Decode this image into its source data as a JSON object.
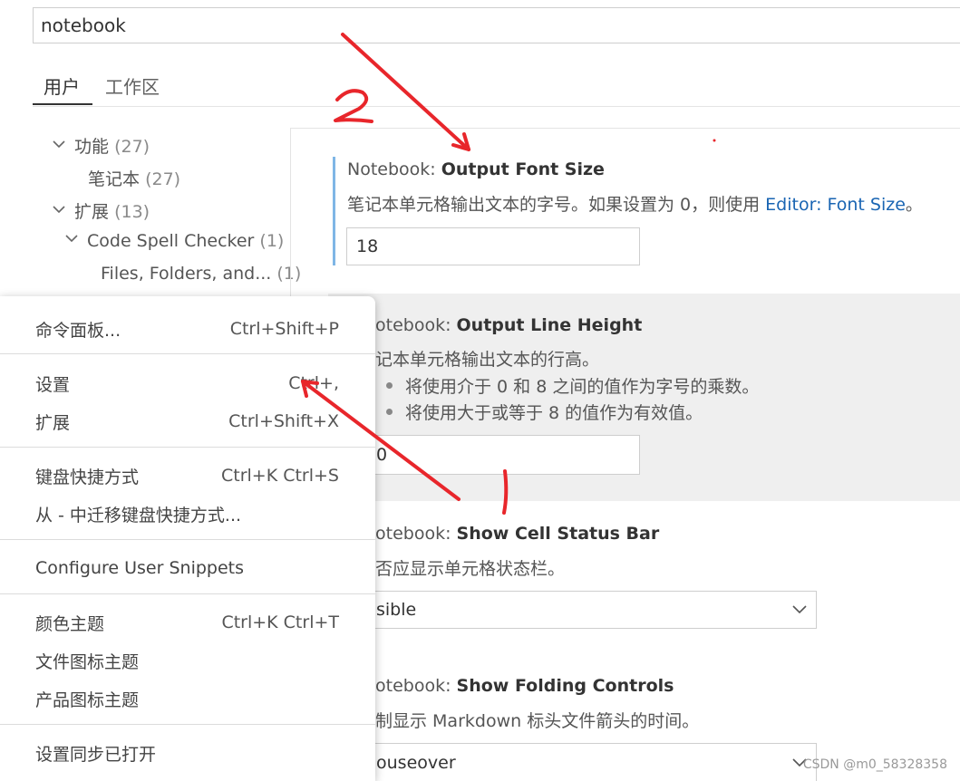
{
  "search": {
    "value": "notebook"
  },
  "tabs": [
    {
      "label": "用户"
    },
    {
      "label": "工作区"
    }
  ],
  "tree": [
    {
      "label": "功能",
      "count": "(27)"
    },
    {
      "label": "笔记本",
      "count": "(27)"
    },
    {
      "label": "扩展",
      "count": "(13)"
    },
    {
      "label": "Code Spell Checker",
      "count": "(1)"
    },
    {
      "label": "Files, Folders, and...",
      "count": "(1)"
    }
  ],
  "settings": [
    {
      "prefix": "Notebook: ",
      "name": "Output Font Size",
      "desc_before": "笔记本单元格输出文本的字号。如果设置为 0，则使用 ",
      "desc_link": "Editor: Font Size",
      "desc_after": "。",
      "value": "18"
    },
    {
      "prefix": "otebook: ",
      "name": "Output Line Height",
      "desc": "记本单元格输出文本的行高。",
      "bullets": [
        "将使用介于 0 和 8 之间的值作为字号的乘数。",
        "将使用大于或等于 8 的值作为有效值。"
      ],
      "value": "0"
    },
    {
      "prefix": "otebook: ",
      "name": "Show Cell Status Bar",
      "desc": "否应显示单元格状态栏。",
      "value": "sible"
    },
    {
      "prefix": "otebook: ",
      "name": "Show Folding Controls",
      "desc": "制显示 Markdown 标头文件箭头的时间。",
      "value": "ouseover"
    }
  ],
  "menu": {
    "groups": [
      [
        {
          "label": "命令面板...",
          "shortcut": "Ctrl+Shift+P"
        }
      ],
      [
        {
          "label": "设置",
          "shortcut": "Ctrl+,"
        },
        {
          "label": "扩展",
          "shortcut": "Ctrl+Shift+X"
        }
      ],
      [
        {
          "label": "键盘快捷方式",
          "shortcut": "Ctrl+K Ctrl+S"
        },
        {
          "label": "从 - 中迁移键盘快捷方式...",
          "shortcut": ""
        }
      ],
      [
        {
          "label": "Configure User Snippets",
          "shortcut": ""
        }
      ],
      [
        {
          "label": "颜色主题",
          "shortcut": "Ctrl+K Ctrl+T"
        },
        {
          "label": "文件图标主题",
          "shortcut": ""
        },
        {
          "label": "产品图标主题",
          "shortcut": ""
        }
      ],
      [
        {
          "label": "设置同步已打开",
          "shortcut": ""
        }
      ]
    ]
  },
  "watermark": "CSDN @m0_58328358",
  "colors": {
    "annotation": "#e8262b",
    "link": "#1a65b3",
    "focus": "#7fb6e6"
  }
}
